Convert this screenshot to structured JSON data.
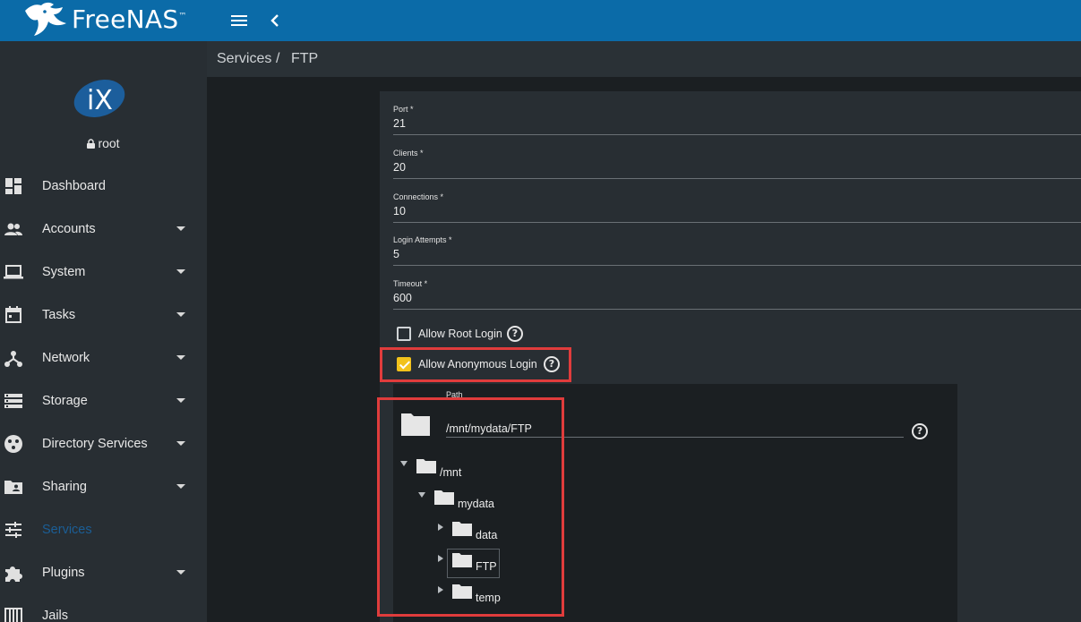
{
  "app": {
    "brand_name": "FreeNAS",
    "brand_tm": "™",
    "accent_color": "#0b6ba8",
    "highlight_color": "#e03c3c",
    "checkbox_color": "#f2c21b"
  },
  "topbar": {
    "menu_icon": "hamburger-menu-icon",
    "collapse_icon": "chevron-left-icon"
  },
  "user": {
    "logo": "iX",
    "name": "root"
  },
  "sidebar": {
    "items": [
      {
        "label": "Dashboard",
        "icon": "dashboard-icon"
      },
      {
        "label": "Accounts",
        "icon": "people-icon"
      },
      {
        "label": "System",
        "icon": "laptop-icon"
      },
      {
        "label": "Tasks",
        "icon": "calendar-icon"
      },
      {
        "label": "Network",
        "icon": "network-icon"
      },
      {
        "label": "Storage",
        "icon": "storage-icon"
      },
      {
        "label": "Directory Services",
        "icon": "directory-icon"
      },
      {
        "label": "Sharing",
        "icon": "shared-folder-icon"
      },
      {
        "label": "Services",
        "icon": "sliders-icon"
      },
      {
        "label": "Plugins",
        "icon": "puzzle-icon"
      },
      {
        "label": "Jails",
        "icon": "jail-icon"
      }
    ]
  },
  "breadcrumb": {
    "parent": "Services",
    "separator": "/",
    "current": "FTP"
  },
  "form": {
    "port": {
      "label": "Port *",
      "value": "21"
    },
    "clients": {
      "label": "Clients *",
      "value": "20"
    },
    "connections": {
      "label": "Connections *",
      "value": "10"
    },
    "login_attempts": {
      "label": "Login Attempts *",
      "value": "5"
    },
    "timeout": {
      "label": "Timeout *",
      "value": "600"
    },
    "allow_root_login": {
      "label": "Allow Root Login",
      "checked": false
    },
    "allow_anonymous_login": {
      "label": "Allow Anonymous Login",
      "checked": true
    },
    "path": {
      "label": "Path",
      "value": "/mnt/mydata/FTP"
    }
  },
  "tree": {
    "mnt": "/mnt",
    "mydata": "mydata",
    "data": "data",
    "ftp": "FTP",
    "temp": "temp"
  },
  "help_glyph": "?"
}
